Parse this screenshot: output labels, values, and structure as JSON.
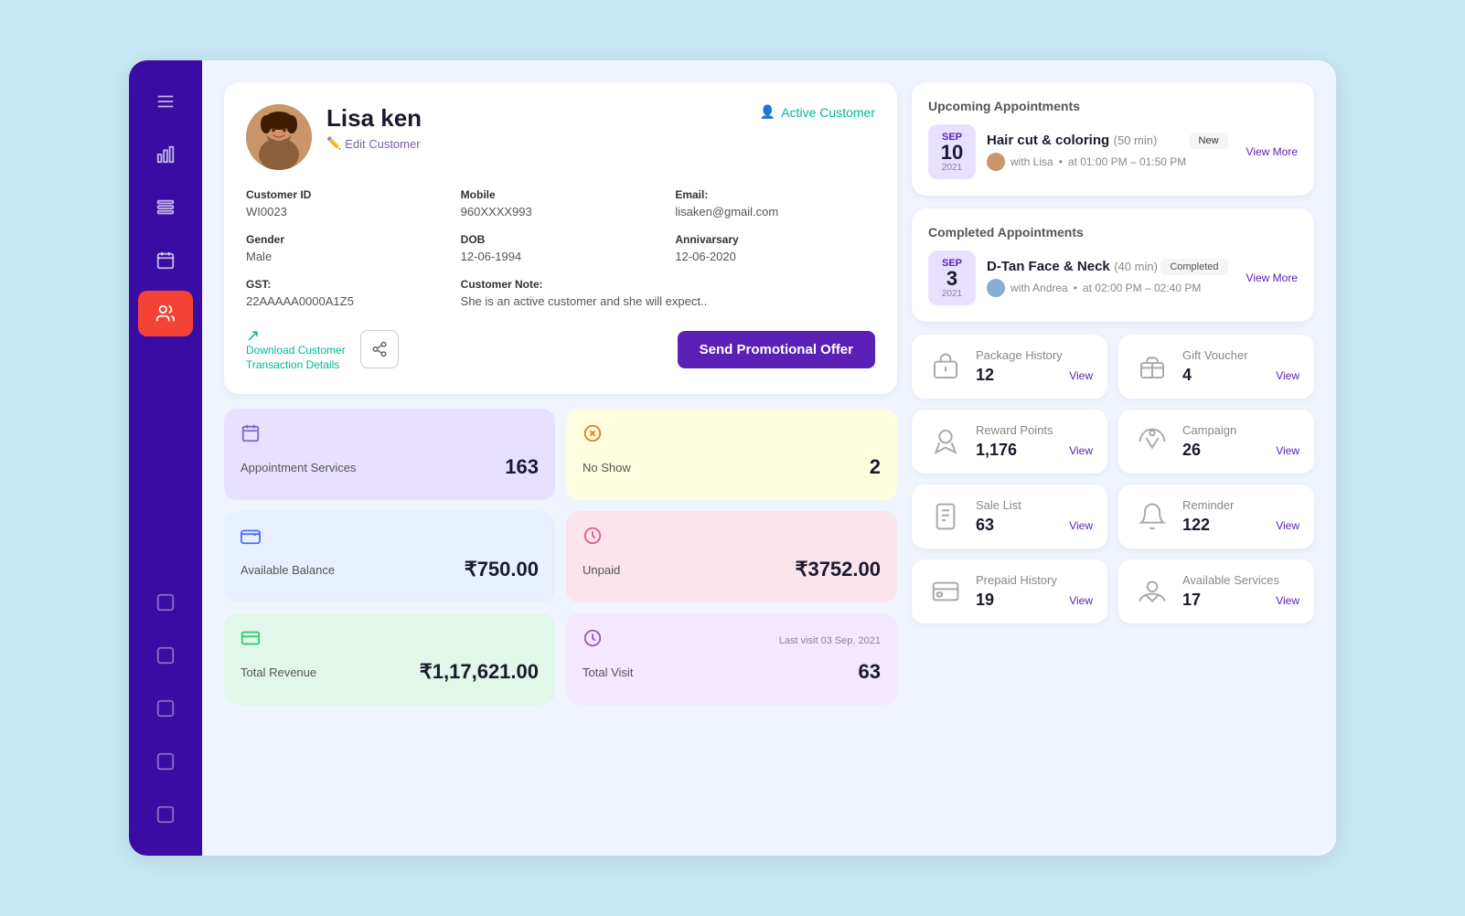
{
  "sidebar": {
    "items": [
      {
        "id": "menu",
        "icon": "menu",
        "active": false
      },
      {
        "id": "chart",
        "icon": "chart",
        "active": false
      },
      {
        "id": "list",
        "icon": "list",
        "active": false
      },
      {
        "id": "calendar",
        "icon": "calendar",
        "active": false
      },
      {
        "id": "customers",
        "icon": "customers",
        "active": true
      },
      {
        "id": "box1",
        "icon": "box",
        "active": false
      },
      {
        "id": "box2",
        "icon": "box",
        "active": false
      },
      {
        "id": "box3",
        "icon": "box",
        "active": false
      },
      {
        "id": "box4",
        "icon": "box",
        "active": false
      },
      {
        "id": "box5",
        "icon": "box",
        "active": false
      }
    ]
  },
  "profile": {
    "name": "Lisa ken",
    "edit_label": "Edit Customer",
    "status": "Active Customer",
    "customer_id_label": "Customer ID",
    "customer_id": "WI0023",
    "mobile_label": "Mobile",
    "mobile": "960XXXX993",
    "email_label": "Email:",
    "email": "lisaken@gmail.com",
    "gender_label": "Gender",
    "gender": "Male",
    "dob_label": "DOB",
    "dob": "12-06-1994",
    "anniversary_label": "Annivarsary",
    "anniversary": "12-06-2020",
    "gst_label": "GST:",
    "gst": "22AAAAA0000A1Z5",
    "note_label": "Customer Note:",
    "note": "She is an active customer and she will expect..",
    "download_label": "Download Customer\nTransaction Details",
    "send_btn": "Send Promotional Offer"
  },
  "stats": [
    {
      "id": "appointment-services",
      "color": "purple",
      "label": "Appointment Services",
      "value": "163",
      "icon": "calendar"
    },
    {
      "id": "no-show",
      "color": "yellow",
      "label": "No Show",
      "value": "2",
      "icon": "no-show"
    },
    {
      "id": "available-balance",
      "color": "light-blue",
      "label": "Available Balance",
      "value": "₹750.00",
      "icon": "wallet"
    },
    {
      "id": "unpaid",
      "color": "pink",
      "label": "Unpaid",
      "value": "₹3752.00",
      "icon": "unpaid"
    },
    {
      "id": "total-revenue",
      "color": "green",
      "label": "Total Revenue",
      "value": "₹1,17,621.00",
      "icon": "revenue"
    },
    {
      "id": "total-visit",
      "color": "lavender",
      "label": "Total Visit",
      "value": "63",
      "icon": "visit",
      "last_visit": "Last visit 03 Sep, 2021"
    }
  ],
  "upcoming_appointments": {
    "section_title": "Upcoming Appointments",
    "items": [
      {
        "month": "SEP",
        "day": "10",
        "year": "2021",
        "title": "Hair cut & coloring",
        "duration": "(50 min)",
        "with": "with Lisa",
        "time": "at 01:00 PM – 01:50 PM",
        "badge": "New",
        "view_label": "View More"
      }
    ]
  },
  "completed_appointments": {
    "section_title": "Completed Appointments",
    "items": [
      {
        "month": "SEP",
        "day": "3",
        "year": "2021",
        "title": "D-Tan Face & Neck",
        "duration": "(40 min)",
        "with": "with Andrea",
        "time": "at 02:00 PM – 02:40 PM",
        "badge": "Completed",
        "view_label": "View More"
      }
    ]
  },
  "info_cards": [
    {
      "id": "package-history",
      "title": "Package History",
      "count": "12",
      "view_label": "View"
    },
    {
      "id": "gift-voucher",
      "title": "Gift Voucher",
      "count": "4",
      "view_label": "View"
    },
    {
      "id": "reward-points",
      "title": "Reward Points",
      "count": "1,176",
      "view_label": "View"
    },
    {
      "id": "campaign",
      "title": "Campaign",
      "count": "26",
      "view_label": "View"
    },
    {
      "id": "sale-list",
      "title": "Sale List",
      "count": "63",
      "view_label": "View"
    },
    {
      "id": "reminder",
      "title": "Reminder",
      "count": "122",
      "view_label": "View"
    },
    {
      "id": "prepaid-history",
      "title": "Prepaid History",
      "count": "19",
      "view_label": "View"
    },
    {
      "id": "available-services",
      "title": "Available Services",
      "count": "17",
      "view_label": "View"
    }
  ]
}
